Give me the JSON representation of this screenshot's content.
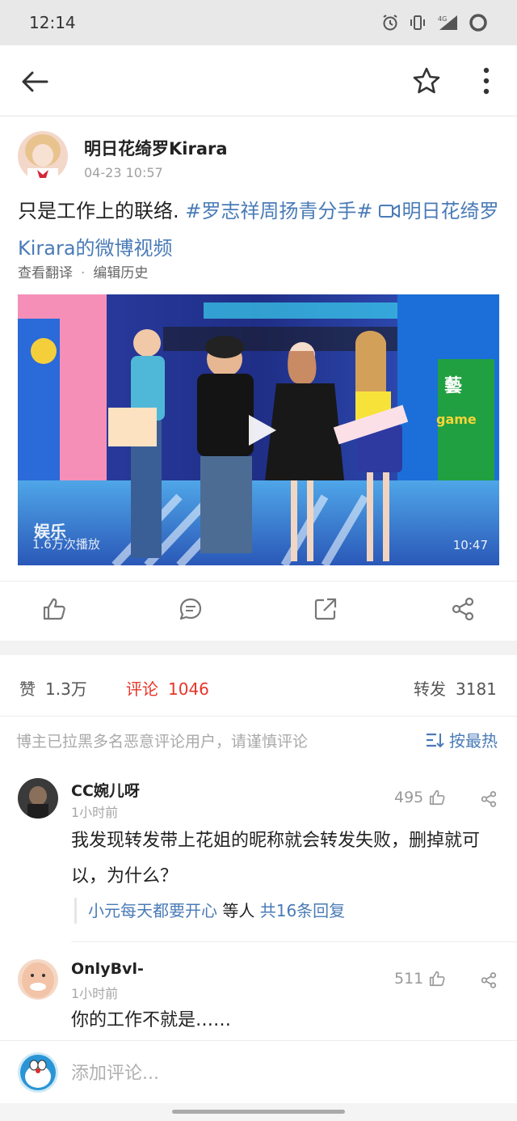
{
  "status_bar": {
    "time": "12:14",
    "network_label": "4G"
  },
  "nav": {
    "back_icon": "back-arrow-icon",
    "star_icon": "star-icon",
    "more_icon": "more-vertical-icon"
  },
  "post": {
    "author": "明日花绮罗Kirara",
    "time": "04-23 10:57",
    "text_plain": "只是工作上的联络. ",
    "hashtag": "#罗志祥周扬青分手#",
    "video_link": "明日花绮罗Kirara的微博视频",
    "translate_label": "查看翻译",
    "edit_history_label": "编辑历史"
  },
  "video": {
    "views": "1.6万次播放",
    "duration": "10:47"
  },
  "actions": [
    {
      "name": "like",
      "icon": "thumbs-up-icon"
    },
    {
      "name": "comment",
      "icon": "comment-bubble-icon"
    },
    {
      "name": "repost",
      "icon": "repost-icon"
    },
    {
      "name": "share",
      "icon": "share-icon"
    }
  ],
  "stats": {
    "likes_label": "赞",
    "likes_value": "1.3万",
    "comments_label": "评论",
    "comments_value": "1046",
    "reposts_label": "转发",
    "reposts_value": "3181"
  },
  "notice": "博主已拉黑多名恶意评论用户，请谨慎评论",
  "sort_label": "按最热",
  "comments": [
    {
      "name": "CC婉儿呀",
      "time": "1小时前",
      "likes": "495",
      "text": "我发现转发带上花姐的昵称就会转发失败，删掉就可以，为什么？",
      "reply_user": "小元每天都要开心",
      "reply_mid": " 等人 ",
      "reply_count": "共16条回复"
    },
    {
      "name": "OnlyBvl-",
      "time": "1小时前",
      "likes": "511",
      "text": "你的工作不就是……"
    }
  ],
  "input": {
    "placeholder": "添加评论..."
  },
  "colors": {
    "link": "#4a7bb7",
    "active": "#e8352a",
    "muted": "#a9a9a9"
  }
}
